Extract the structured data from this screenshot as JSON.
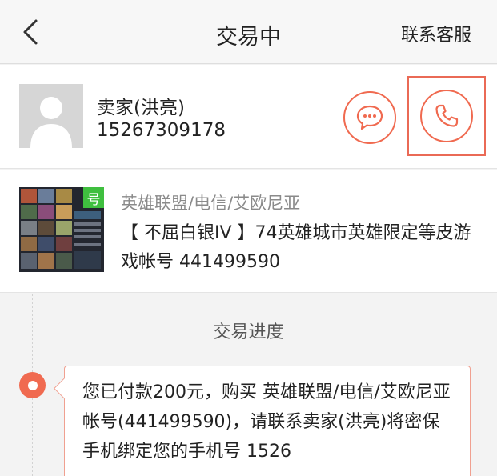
{
  "header": {
    "title": "交易中",
    "contact_service": "联系客服"
  },
  "seller": {
    "name": "卖家(洪亮)",
    "phone": "15267309178"
  },
  "product": {
    "badge": "号",
    "category": "英雄联盟/电信/艾欧尼亚",
    "title": "【 不屈白银IV 】74英雄城市英雄限定等皮游戏帐号  441499590"
  },
  "progress": {
    "title": "交易进度",
    "message": "您已付款200元，购买 英雄联盟/电信/艾欧尼亚 帐号(441499590)，请联系卖家(洪亮)将密保手机绑定您的手机号 1526"
  },
  "colors": {
    "accent": "#f06a50",
    "highlight_border": "#ea6a56"
  },
  "icons": {
    "back": "chevron-left-icon",
    "chat": "chat-bubble-icon",
    "call": "phone-icon",
    "avatar": "user-silhouette-icon"
  }
}
